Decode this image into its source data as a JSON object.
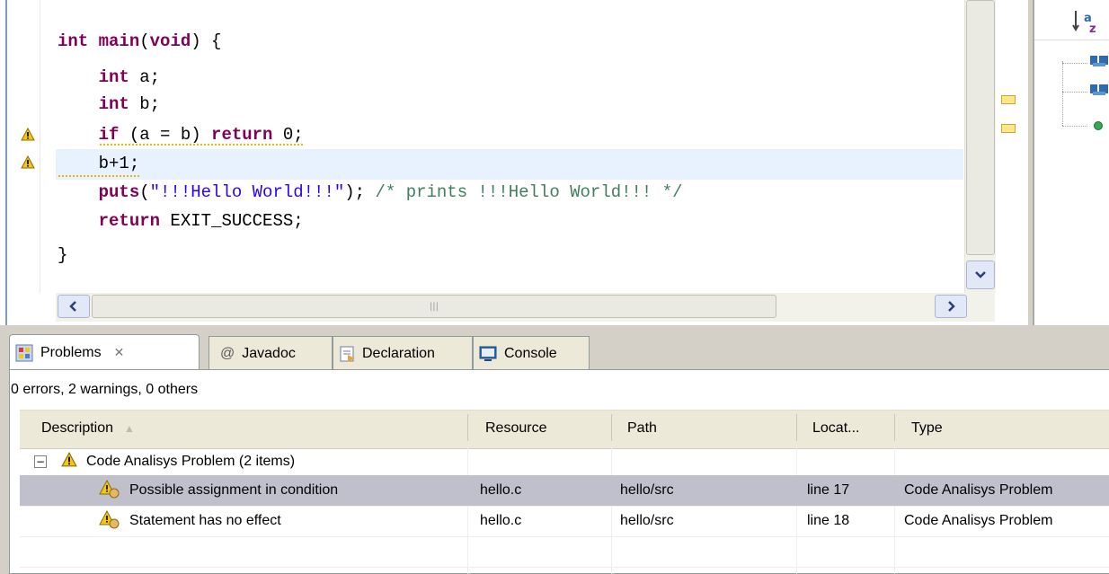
{
  "editor": {
    "lines": [
      {
        "parts": [
          {
            "t": "int",
            "c": "kw"
          },
          {
            "t": " "
          },
          {
            "t": "main",
            "c": "kw"
          },
          {
            "t": "("
          },
          {
            "t": "void",
            "c": "kw"
          },
          {
            "t": ") {"
          }
        ]
      },
      {
        "parts": [
          {
            "t": "    "
          },
          {
            "t": "int",
            "c": "kw"
          },
          {
            "t": " a;"
          }
        ]
      },
      {
        "parts": [
          {
            "t": "    "
          },
          {
            "t": "int",
            "c": "kw"
          },
          {
            "t": " b;"
          }
        ]
      },
      {
        "parts": [
          {
            "t": "    "
          },
          {
            "t": "if",
            "c": "kw"
          },
          {
            "t": " (a = b) "
          },
          {
            "t": "return",
            "c": "kw"
          },
          {
            "t": " 0;"
          }
        ]
      },
      {
        "parts": [
          {
            "t": "    b+1;"
          }
        ]
      },
      {
        "parts": [
          {
            "t": "    "
          },
          {
            "t": "puts",
            "c": "kw"
          },
          {
            "t": "("
          },
          {
            "t": "\"!!!Hello World!!!\"",
            "c": "str"
          },
          {
            "t": "); "
          },
          {
            "t": "/* prints !!!Hello World!!! */",
            "c": "cmt"
          }
        ]
      },
      {
        "parts": [
          {
            "t": "    "
          },
          {
            "t": "return",
            "c": "kw"
          },
          {
            "t": " EXIT_SUCCESS;"
          }
        ]
      },
      {
        "parts": [
          {
            "t": "}"
          }
        ]
      }
    ],
    "warning_icon": "warning-triangle-icon"
  },
  "scrollbars": {
    "left_arrow": "<",
    "right_arrow": ">",
    "down_arrow": "v",
    "thumb_grip": "|||"
  },
  "outline": {
    "sort_icon": "sort-alphabetical-icon"
  },
  "tabs": [
    {
      "label": "Problems",
      "close": "✕",
      "icon": "problems-icon"
    },
    {
      "label": "Javadoc",
      "icon": "at-icon",
      "prefix": "@"
    },
    {
      "label": "Declaration",
      "icon": "declaration-icon"
    },
    {
      "label": "Console",
      "icon": "console-icon"
    }
  ],
  "problems": {
    "summary": "0 errors, 2 warnings, 0 others",
    "columns": [
      "Description",
      "Resource",
      "Path",
      "Locat...",
      "Type"
    ],
    "sort_indicator": "▲",
    "group": {
      "expander": "−",
      "label": "Code Analisys Problem (2 items)"
    },
    "rows": [
      {
        "description": "Possible assignment in condition",
        "resource": "hello.c",
        "path": "hello/src",
        "location": "line 17",
        "type": "Code Analisys Problem"
      },
      {
        "description": "Statement has no effect",
        "resource": "hello.c",
        "path": "hello/src",
        "location": "line 18",
        "type": "Code Analisys Problem"
      }
    ]
  },
  "colors": {
    "keyword": "#7f0055",
    "string": "#2a00ff",
    "comment": "#3f7f5f",
    "current_line": "#e8f2fe",
    "selected_row": "#c0c0cc"
  }
}
